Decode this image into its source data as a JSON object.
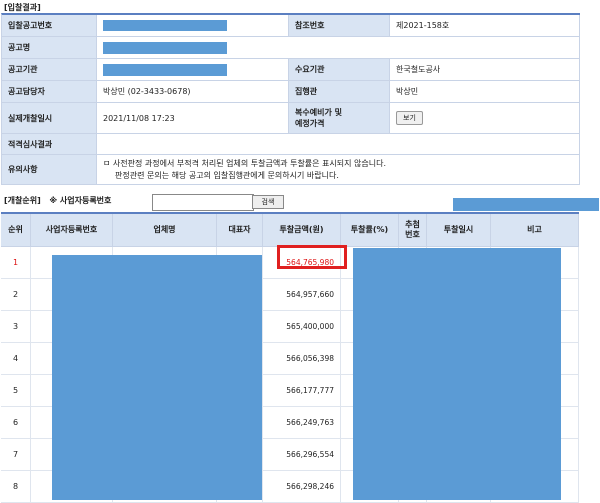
{
  "section_title": "[입찰결과]",
  "info": {
    "bid_notice_no_label": "입찰공고번호",
    "ref_no_label": "참조번호",
    "ref_no_value": "제2021-158호",
    "notice_name_label": "공고명",
    "notice_agency_label": "공고기관",
    "demand_agency_label": "수요기관",
    "demand_agency_value": "한국철도공사",
    "contact_label": "공고담당자",
    "contact_value": "박상민 (02-3433-0678)",
    "executor_label": "집행관",
    "executor_value": "박상민",
    "opening_datetime_label": "실제개찰일시",
    "opening_datetime_value": "2021/11/08 17:23",
    "reserve_price_label_line1": "복수예비가 및",
    "reserve_price_label_line2": "예정가격",
    "view_button": "보기",
    "review_result_label": "적격심사결과",
    "notes_label": "유의사항",
    "notes_line1": "ㅁ 사전판정 과정에서 부적격 처리된 업체의 투찰금액과 투찰률은 표시되지 않습니다.",
    "notes_line2": "판정관련 문의는 해당 공고의 입찰집행관에게 문의하시기 바랍니다."
  },
  "search": {
    "ranking_label": "[개찰순위]",
    "biz_no_label": "※ 사업자등록번호",
    "input_value": "",
    "search_button": "검색"
  },
  "results": {
    "headers": {
      "rank": "순위",
      "biz_no": "사업자등록번호",
      "company": "업체명",
      "rep": "대표자",
      "amount": "투찰금액(원)",
      "rate": "투찰률(%)",
      "lot_line1": "추첨",
      "lot_line2": "번호",
      "date": "투찰일시",
      "note": "비고"
    },
    "rows": [
      {
        "rank": "1",
        "amount": "564,765,980"
      },
      {
        "rank": "2",
        "amount": "564,957,660"
      },
      {
        "rank": "3",
        "amount": "565,400,000"
      },
      {
        "rank": "4",
        "amount": "566,056,398"
      },
      {
        "rank": "5",
        "amount": "566,177,777"
      },
      {
        "rank": "6",
        "amount": "566,249,763"
      },
      {
        "rank": "7",
        "amount": "566,296,554"
      },
      {
        "rank": "8",
        "amount": "566,298,246"
      }
    ]
  }
}
